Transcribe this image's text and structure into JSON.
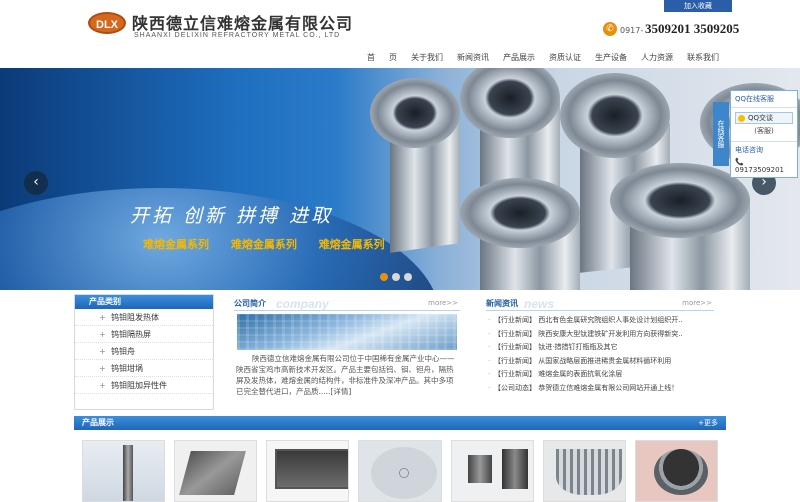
{
  "header": {
    "logo_text": "DLX",
    "company_cn": "陕西德立信难熔金属有限公司",
    "company_en": "SHAANXI DELIXIN  REFRACTORY METAL CO., LTD",
    "phone_prefix": "0917-",
    "phone_numbers": "3509201 3509205",
    "favorite_label": "加入收藏"
  },
  "nav": [
    "首",
    "页",
    "关于我们",
    "新闻资讯",
    "产品展示",
    "资质认证",
    "生产设备",
    "人力资源",
    "联系我们"
  ],
  "banner": {
    "slogan": "开拓 创新 拼搏 进取",
    "series": [
      "难熔金属系列",
      "难熔金属系列",
      "难熔金属系列"
    ],
    "prev_label": "‹",
    "next_label": "›",
    "slides_total": 3,
    "slide_active": 1
  },
  "qq_panel": {
    "tab_label": "在线客服",
    "title": "QQ在线客服",
    "qq_button": "QQ交谈",
    "qq_sub": "(客服)",
    "phone_heading": "电话咨询",
    "phone": "09173509201"
  },
  "categories": {
    "title": "产品类别",
    "items": [
      "钨钼阻发热体",
      "钨钼隔热屏",
      "钨钼舟",
      "钨钼坩埚",
      "钨钼阻加异性件"
    ]
  },
  "intro": {
    "title": "公司简介",
    "title_en": "company",
    "more": "more>>",
    "text": "陕西德立信难熔金属有限公司位于中国稀有金属产业中心——陕西省宝鸡市高新技术开发区。产品主要包括钨、钼、钽舟，隔热屏及发热体，难熔金属的结构件，非标准件及深冲产品。其中多项已完全替代进口，产品质.....[详情]"
  },
  "news": {
    "title": "新闻资讯",
    "title_en": "news",
    "more": "more>>",
    "items": [
      "【行业新闻】 西北有色金属研究院组织人事处设计划组织开..",
      "【行业新闻】 陕西安康大型钛建铁矿开发利用方向获得新突..",
      "【行业新闻】 钛进·措措钉打瓶瓶及其它",
      "【行业新闻】 从国家战略层面推进稀贵金属材料循环利用",
      "【行业新闻】 难熔金属的表面抗氧化涂层",
      "【公司动态】 恭贺德立信难熔金属有限公司网站开通上线！"
    ]
  },
  "products": {
    "title": "产品展示",
    "more": "+更多",
    "images": [
      "tungsten-rod",
      "molybdenum-boat",
      "metal-plate",
      "perforated-disc",
      "crucible-set",
      "heat-shield-basket",
      "tungsten-crucible"
    ]
  },
  "colors": {
    "brand_blue": "#1f66b8",
    "accent_orange": "#e8900c",
    "logo_orange": "#d2691e",
    "slogan_gold": "#f5b800"
  }
}
